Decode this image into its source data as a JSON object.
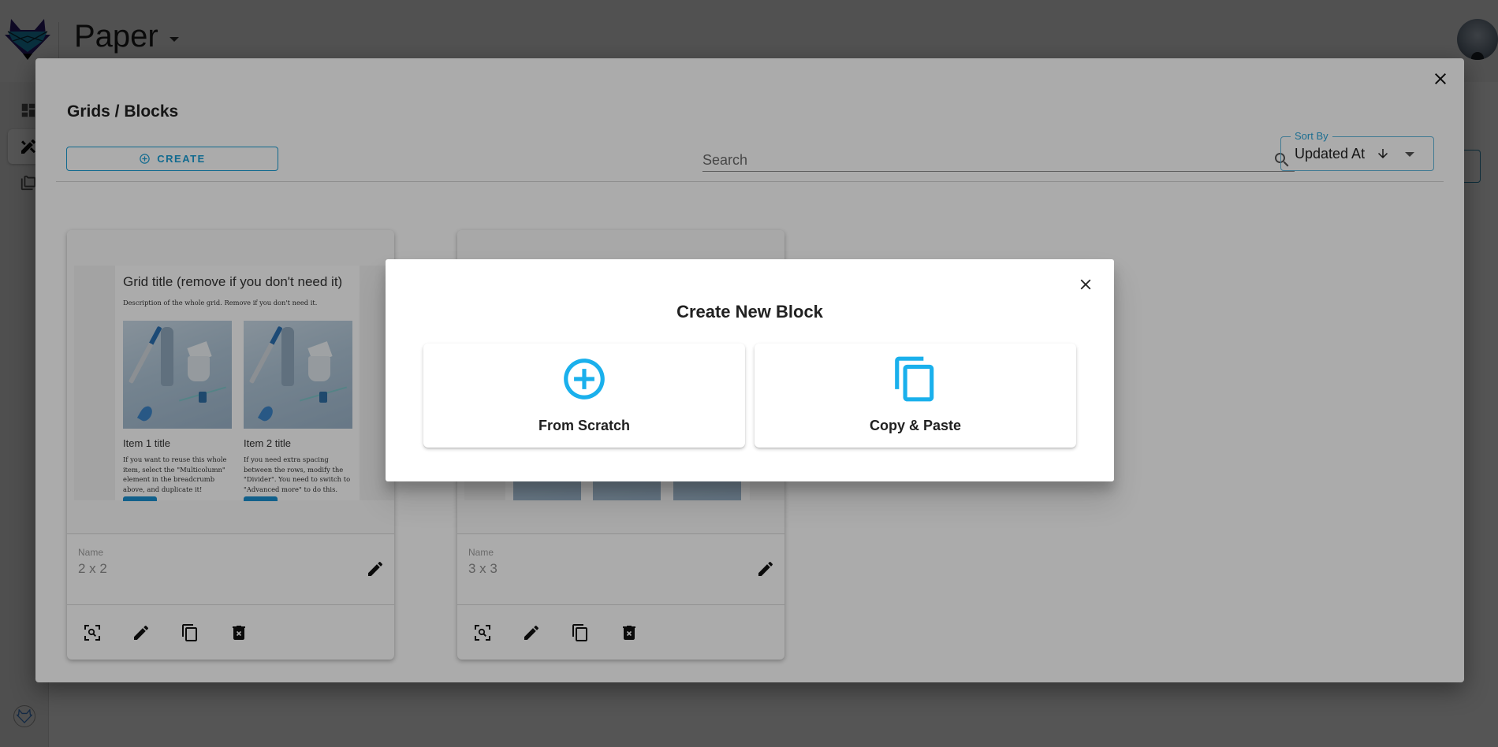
{
  "app": {
    "title": "Paper",
    "avatar_alt": "user-avatar"
  },
  "sidebar": {
    "items": [
      {
        "name": "dashboard",
        "icon": "dashboard-icon",
        "active": false
      },
      {
        "name": "design-tools",
        "icon": "design-tools-icon",
        "active": true
      },
      {
        "name": "library",
        "icon": "library-icon",
        "active": false
      }
    ]
  },
  "blocks_modal": {
    "title": "Grids / Blocks",
    "create_label": "CREATE",
    "search": {
      "placeholder": "Search",
      "value": ""
    },
    "sort": {
      "label": "Sort By",
      "value": "Updated At",
      "direction": "descending"
    },
    "cards": [
      {
        "name_label": "Name",
        "name": "2 x 2",
        "preview": {
          "grid_title": "Grid title (remove if you don't need it)",
          "grid_description": "Description of the whole grid. Remove if you don't need it.",
          "items": [
            {
              "title": "Item 1 title",
              "text": "If you want to reuse this whole item, select the \"Multicolumn\" element in the breadcrumb above, and duplicate it!"
            },
            {
              "title": "Item 2 title",
              "text": "If you need extra spacing between the rows, modify the \"Divider\". You need to switch to \"Advanced more\" to do this."
            }
          ]
        },
        "actions": [
          "preview",
          "edit",
          "duplicate",
          "delete"
        ]
      },
      {
        "name_label": "Name",
        "name": "3 x 3",
        "actions": [
          "preview",
          "edit",
          "duplicate",
          "delete"
        ]
      }
    ]
  },
  "create_dialog": {
    "title": "Create New Block",
    "options": [
      {
        "label": "From Scratch",
        "icon": "add-circle-icon"
      },
      {
        "label": "Copy & Paste",
        "icon": "copy-icon"
      }
    ]
  },
  "colors": {
    "accent": "#1ab0ec",
    "outline_accent": "#1a9fd6"
  }
}
